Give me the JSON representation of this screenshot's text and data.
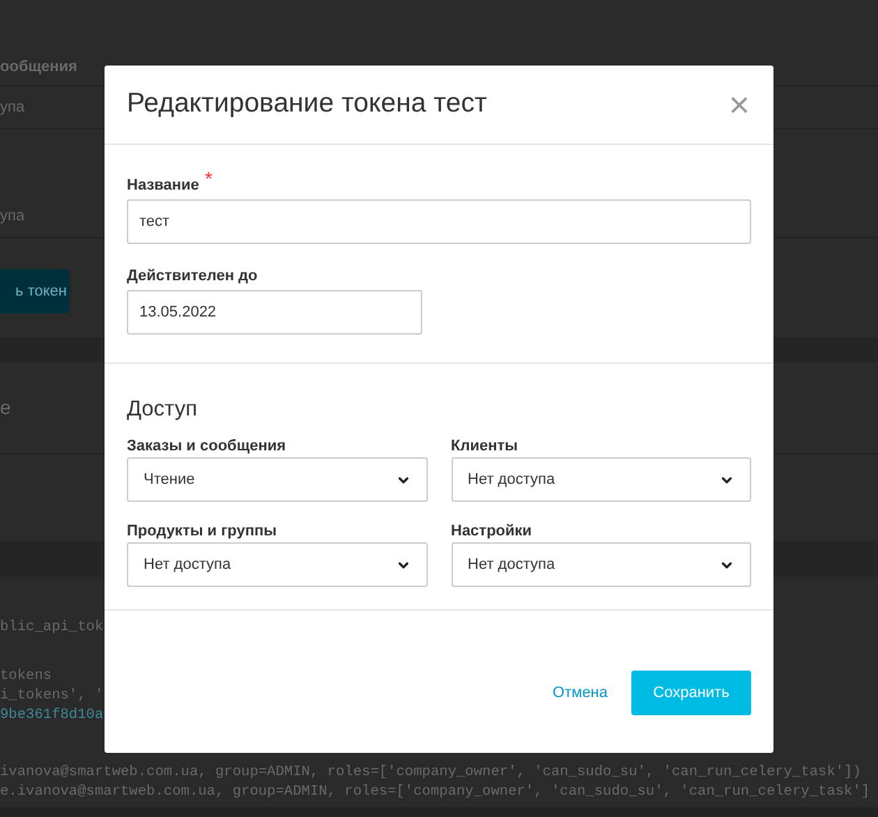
{
  "background": {
    "header_cell": "ообщения",
    "rows": [
      "упа",
      "упа"
    ],
    "button": "ь токен",
    "section_heading": "е",
    "code_blocks": [
      [
        {
          "text": "blic_api_tok",
          "kind": "plain"
        }
      ],
      [
        {
          "text": "tokens",
          "kind": "plain"
        },
        {
          "text": "i_tokens', '",
          "kind": "plain"
        },
        {
          "text": "9be361f8d10a",
          "kind": "hash"
        }
      ],
      [
        {
          "text": "ivanova@smartweb.com.ua, group=ADMIN, roles=['company_owner', 'can_sudo_su', 'can_run_celery_task'])",
          "kind": "plain"
        },
        {
          "text": "e.ivanova@smartweb.com.ua, group=ADMIN, roles=['company_owner', 'can_sudo_su', 'can_run_celery_task']",
          "kind": "plain"
        }
      ]
    ]
  },
  "modal": {
    "title": "Редактирование токена тест",
    "close": "×",
    "fields": [
      {
        "label": "Название",
        "required_mark": "*",
        "value": "тест",
        "kind": "wide"
      },
      {
        "label": "Действителен до",
        "value": "13.05.2022",
        "kind": "narrow"
      }
    ],
    "access": {
      "heading": "Доступ",
      "selects": [
        {
          "label": "Заказы и сообщения",
          "value": "Чтение"
        },
        {
          "label": "Клиенты",
          "value": "Нет доступа"
        },
        {
          "label": "Продукты и группы",
          "value": "Нет доступа"
        },
        {
          "label": "Настройки",
          "value": "Нет доступа"
        }
      ]
    },
    "cancel": "Отмена",
    "save": "Сохранить"
  }
}
